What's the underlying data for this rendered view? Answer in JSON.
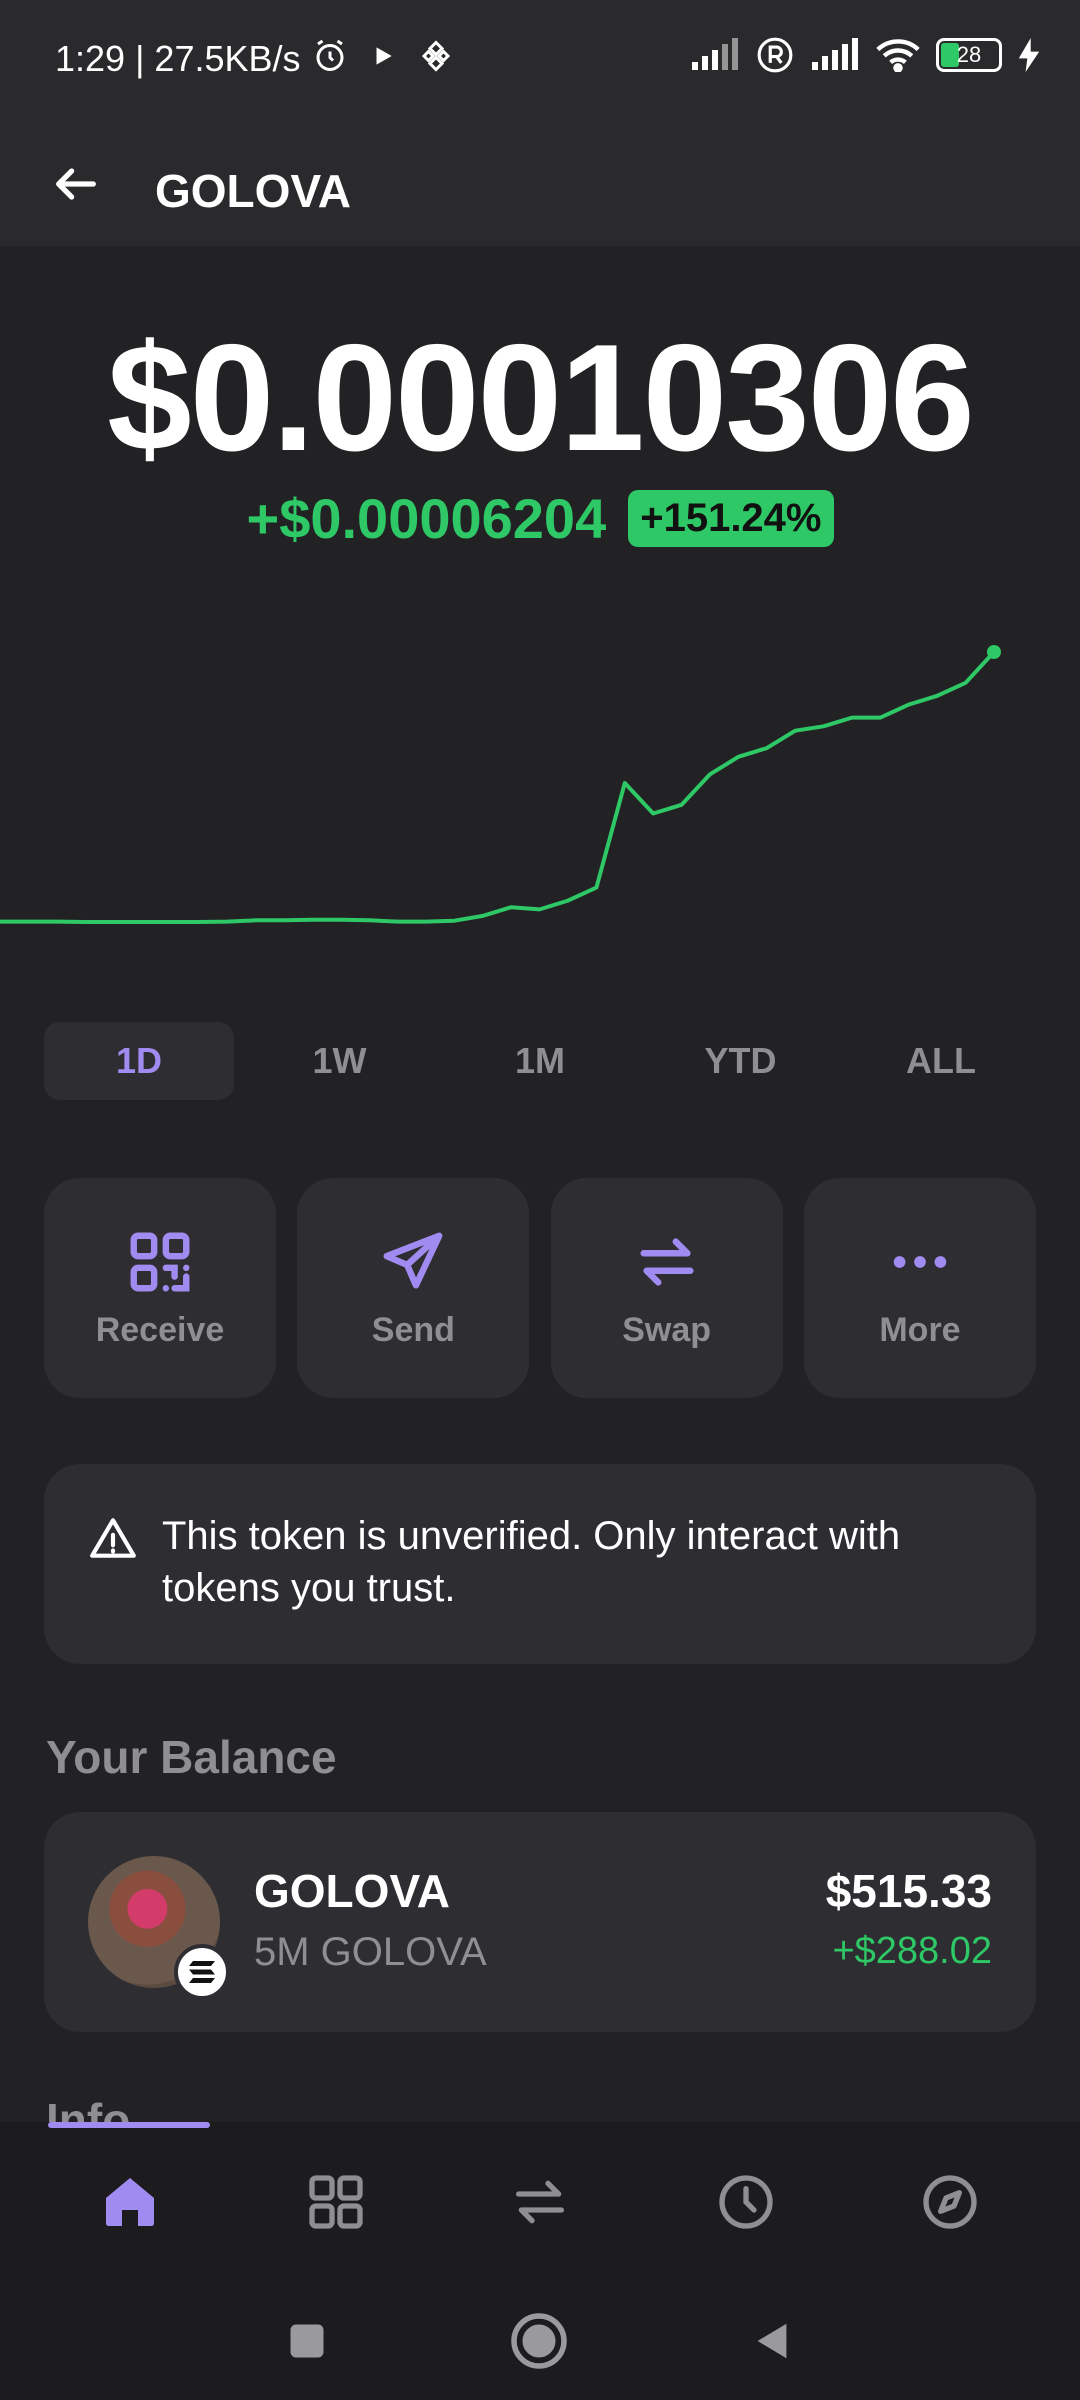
{
  "status_bar": {
    "time_speed": "1:29 | 27.5KB/s",
    "battery": "28"
  },
  "header": {
    "title": "GOLOVA"
  },
  "price": {
    "current": "$0.00010306",
    "change_abs": "+$0.00006204",
    "change_pct": "+151.24%"
  },
  "chart_data": {
    "type": "line",
    "color": "#2ec866",
    "series": [
      {
        "values": [
          4.12e-05,
          4.12e-05,
          4.12e-05,
          4.11e-05,
          4.11e-05,
          4.11e-05,
          4.11e-05,
          4.11e-05,
          4.12e-05,
          4.15e-05,
          4.15e-05,
          4.16e-05,
          4.16e-05,
          4.15e-05,
          4.12e-05,
          4.12e-05,
          4.14e-05,
          4.25e-05,
          4.45e-05,
          4.4e-05,
          4.6e-05,
          4.9e-05,
          7.3e-05,
          6.6e-05,
          6.8e-05,
          7.5e-05,
          7.9e-05,
          8.1e-05,
          8.5e-05,
          8.6e-05,
          8.8e-05,
          8.8e-05,
          9.1e-05,
          9.3e-05,
          9.6e-05,
          0.00010306
        ]
      }
    ]
  },
  "range_tabs": [
    "1D",
    "1W",
    "1M",
    "YTD",
    "ALL"
  ],
  "active_range": "1D",
  "actions": {
    "receive": "Receive",
    "send": "Send",
    "swap": "Swap",
    "more": "More"
  },
  "warning": {
    "text": "This token is unverified. Only interact with tokens you trust."
  },
  "balance": {
    "heading": "Your Balance",
    "token_name": "GOLOVA",
    "token_amount": "5M GOLOVA",
    "value": "$515.33",
    "change": "+$288.02"
  },
  "info_heading": "Info",
  "colors": {
    "accent": "#a08cf0",
    "positive": "#2ec866",
    "background": "#222224",
    "card": "#2e2e32"
  }
}
